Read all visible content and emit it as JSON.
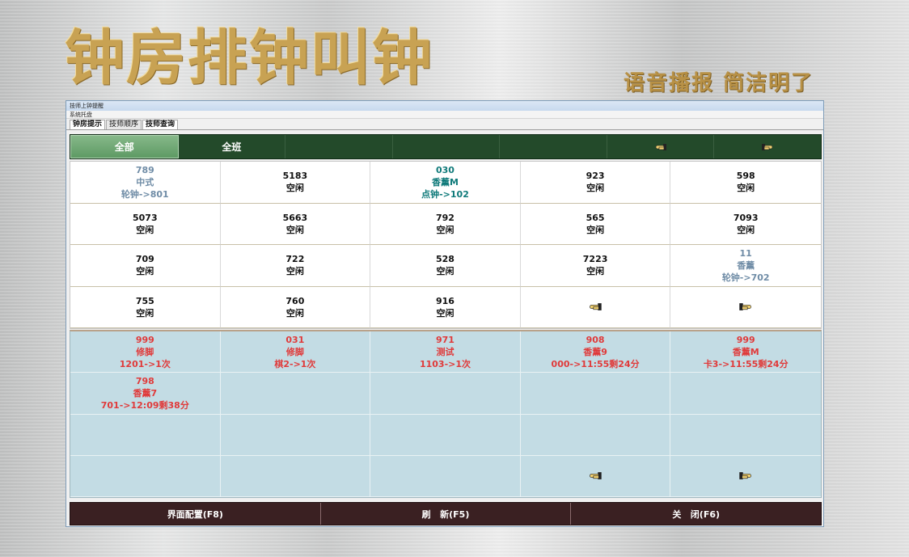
{
  "hero": {
    "title": "钟房排钟叫钟",
    "slogan": "语音播报 简洁明了"
  },
  "window": {
    "title": "技师上钟提醒",
    "menu": "系统托盘",
    "tabs": [
      {
        "label": "钟房提示",
        "active": true
      },
      {
        "label": "技师顺序",
        "active": false
      },
      {
        "label": "技师查询",
        "active": false
      }
    ]
  },
  "toolbar": {
    "cells": [
      {
        "label": "全部",
        "selected": true
      },
      {
        "label": "全班",
        "selected": false
      },
      {
        "label": "",
        "selected": false
      },
      {
        "label": "",
        "selected": false
      },
      {
        "label": "",
        "selected": false
      },
      {
        "label": "",
        "icon": "hand-pointing-left-icon"
      },
      {
        "label": "",
        "icon": "hand-pointing-right-icon"
      }
    ]
  },
  "idle_grid": {
    "cells": [
      {
        "lines": [
          "789",
          "中式",
          "轮钟->801"
        ],
        "color": "#6f8ca6"
      },
      {
        "lines": [
          "5183",
          "空闲"
        ],
        "color": "#111111"
      },
      {
        "lines": [
          "030",
          "香薰M",
          "点钟->102"
        ],
        "color": "#0f7a7a"
      },
      {
        "lines": [
          "923",
          "空闲"
        ],
        "color": "#111111"
      },
      {
        "lines": [
          "598",
          "空闲"
        ],
        "color": "#111111"
      },
      {
        "lines": [
          "5073",
          "空闲"
        ],
        "color": "#111111"
      },
      {
        "lines": [
          "5663",
          "空闲"
        ],
        "color": "#111111"
      },
      {
        "lines": [
          "792",
          "空闲"
        ],
        "color": "#111111"
      },
      {
        "lines": [
          "565",
          "空闲"
        ],
        "color": "#111111"
      },
      {
        "lines": [
          "7093",
          "空闲"
        ],
        "color": "#111111"
      },
      {
        "lines": [
          "709",
          "空闲"
        ],
        "color": "#111111"
      },
      {
        "lines": [
          "722",
          "空闲"
        ],
        "color": "#111111"
      },
      {
        "lines": [
          "528",
          "空闲"
        ],
        "color": "#111111"
      },
      {
        "lines": [
          "7223",
          "空闲"
        ],
        "color": "#111111"
      },
      {
        "lines": [
          "11",
          "香薰",
          "轮钟->702"
        ],
        "color": "#6f8ca6"
      },
      {
        "lines": [
          "755",
          "空闲"
        ],
        "color": "#111111"
      },
      {
        "lines": [
          "760",
          "空闲"
        ],
        "color": "#111111"
      },
      {
        "lines": [
          "916",
          "空闲"
        ],
        "color": "#111111"
      },
      {
        "icon": "hand-pointing-left-icon"
      },
      {
        "icon": "hand-pointing-right-icon"
      }
    ]
  },
  "busy_grid": {
    "cells": [
      {
        "lines": [
          "999",
          "修脚",
          "1201->1次"
        ],
        "color": "#e03a3a"
      },
      {
        "lines": [
          "031",
          "修脚",
          "棋2->1次"
        ],
        "color": "#e03a3a"
      },
      {
        "lines": [
          "971",
          "测试",
          "1103->1次"
        ],
        "color": "#e03a3a"
      },
      {
        "lines": [
          "908",
          "香薰9",
          "000->11:55剩24分"
        ],
        "color": "#e03a3a"
      },
      {
        "lines": [
          "999",
          "香薰M",
          "卡3->11:55剩24分"
        ],
        "color": "#e03a3a"
      },
      {
        "lines": [
          "798",
          "香薰7",
          "701->12:09剩38分"
        ],
        "color": "#e03a3a"
      },
      {
        "lines": []
      },
      {
        "lines": []
      },
      {
        "lines": []
      },
      {
        "lines": []
      },
      {
        "lines": []
      },
      {
        "lines": []
      },
      {
        "lines": []
      },
      {
        "lines": []
      },
      {
        "lines": []
      },
      {
        "lines": []
      },
      {
        "lines": []
      },
      {
        "lines": []
      },
      {
        "icon": "hand-pointing-left-icon"
      },
      {
        "icon": "hand-pointing-right-icon"
      }
    ]
  },
  "footer": {
    "buttons": [
      {
        "label": "界面配置(F8)"
      },
      {
        "label": "刷   新(F5)"
      },
      {
        "label": "关   闭(F6)"
      }
    ]
  },
  "colors": {
    "toolbar_bg": "#234a2a",
    "busy_bg": "#c3dce4",
    "footer_bg": "#3a2022",
    "gold": "#c8a253"
  }
}
